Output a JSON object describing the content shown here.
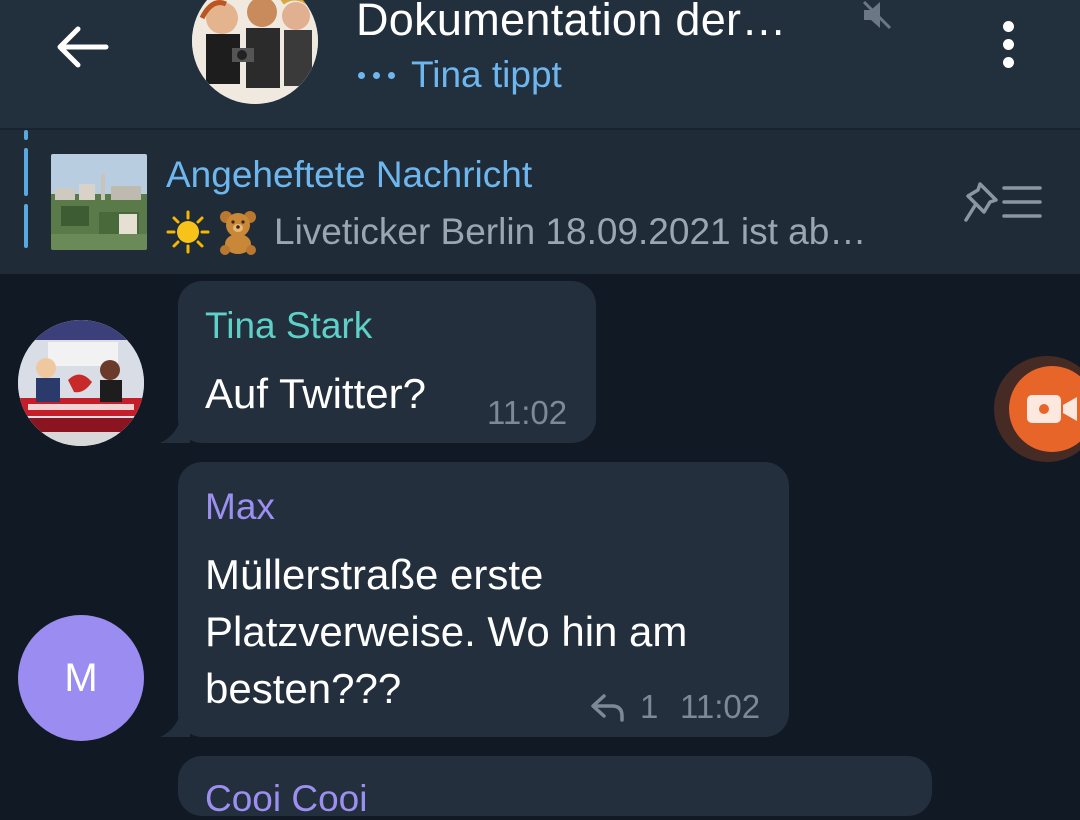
{
  "header": {
    "title": "Dokumentation der…",
    "status": "Tina tippt"
  },
  "pinned": {
    "title": "Angeheftete Nachricht",
    "text": "Liveticker Berlin 18.09.2021 ist ab…",
    "emojis": [
      "sun",
      "teddy-bear"
    ]
  },
  "messages": [
    {
      "sender": "Tina Stark",
      "sender_color": "#5fd0c8",
      "text": "Auf Twitter?",
      "time": "11:02"
    },
    {
      "sender": "Max",
      "sender_color": "#9d8ff0",
      "avatar_letter": "M",
      "avatar_color": "#9a8cf0",
      "text_lines": [
        "Müllerstraße erste",
        "Platzverweise. Wo hin am",
        "besten???"
      ],
      "replies": "1",
      "time": "11:02"
    },
    {
      "sender": "Cooi Cooi"
    }
  ],
  "colors": {
    "background": "#111a24",
    "header": "#222f3d",
    "bubble": "#232f3c",
    "accent": "#6eb6ee",
    "video_button": "#e8652a"
  }
}
